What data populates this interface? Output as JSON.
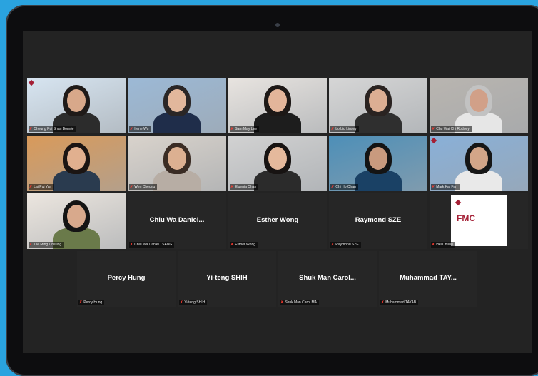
{
  "device": {
    "camera_icon": "camera-dot-icon"
  },
  "participants": [
    {
      "row": 0,
      "col": 0,
      "kind": "video",
      "label": "Cheung Pui Shan Bonnie",
      "palette": {
        "bg": "#d7e5f1",
        "skin": "#d8a88a",
        "hair": "#1f1a18",
        "cloth": "#2c2c2c"
      },
      "logo": true
    },
    {
      "row": 0,
      "col": 1,
      "kind": "video",
      "label": "Irene Wu",
      "palette": {
        "bg": "#9cb9d6",
        "skin": "#e2b79c",
        "hair": "#2a2626",
        "cloth": "#1f2d4a"
      },
      "logo": false
    },
    {
      "row": 0,
      "col": 2,
      "kind": "video",
      "label": "Sam May Lee",
      "palette": {
        "bg": "#e8e4e0",
        "skin": "#e3b59a",
        "hair": "#1d1816",
        "cloth": "#1d1d1d"
      },
      "logo": false
    },
    {
      "row": 0,
      "col": 3,
      "kind": "video",
      "label": "Lo Liu Linsey",
      "palette": {
        "bg": "#d6d6d6",
        "skin": "#dcae93",
        "hair": "#2a2321",
        "cloth": "#2f2f2f"
      },
      "logo": false
    },
    {
      "row": 0,
      "col": 4,
      "kind": "video",
      "label": "Chu Wai Chi Rodney",
      "palette": {
        "bg": "#b9b5b0",
        "skin": "#d1a088",
        "hair": "#c2c2c2",
        "cloth": "#e6e6e6"
      },
      "logo": false
    },
    {
      "row": 1,
      "col": 0,
      "kind": "video",
      "label": "Lai Pui Yan",
      "palette": {
        "bg": "#d99a5a",
        "skin": "#e1b08f",
        "hair": "#1b1513",
        "cloth": "#2a3b4f"
      },
      "logo": false
    },
    {
      "row": 1,
      "col": 1,
      "kind": "video",
      "label": "Wen Cheung",
      "palette": {
        "bg": "#d9d3cc",
        "skin": "#dcb091",
        "hair": "#3a2c24",
        "cloth": "#b7ada4"
      },
      "logo": false
    },
    {
      "row": 1,
      "col": 2,
      "kind": "video",
      "label": "Elgenia Chan",
      "palette": {
        "bg": "#d2d2d2",
        "skin": "#e5b99c",
        "hair": "#171312",
        "cloth": "#2b2b2b"
      },
      "logo": false
    },
    {
      "row": 1,
      "col": 3,
      "kind": "video",
      "label": "Chi Ho Chan",
      "palette": {
        "bg": "#4d8fb8",
        "skin": "#c99a7e",
        "hair": "#141414",
        "cloth": "#1a4165"
      },
      "logo": false
    },
    {
      "row": 1,
      "col": 4,
      "kind": "video",
      "label": "Mark Kai Fan",
      "palette": {
        "bg": "#89b0d8",
        "skin": "#d3a588",
        "hair": "#161616",
        "cloth": "#e9e9e9"
      },
      "logo": true,
      "active": true
    },
    {
      "row": 2,
      "col": 0,
      "kind": "video",
      "label": "Tse Ming Cheung",
      "palette": {
        "bg": "#ece6df",
        "skin": "#d8a98c",
        "hair": "#141414",
        "cloth": "#6a7a4a"
      },
      "logo": false
    },
    {
      "row": 2,
      "col": 1,
      "kind": "name",
      "display": "Chiu Wa Daniel...",
      "label": "Chiu Wa Daniel TSANG"
    },
    {
      "row": 2,
      "col": 2,
      "kind": "name",
      "display": "Esther Wong",
      "label": "Esther Wong"
    },
    {
      "row": 2,
      "col": 3,
      "kind": "name",
      "display": "Raymond SZE",
      "label": "Raymond SZE"
    },
    {
      "row": 2,
      "col": 4,
      "kind": "fmc",
      "label": "Hei Chung",
      "fmc_text": "FMC"
    },
    {
      "row": 3,
      "col": 0,
      "kind": "name",
      "display": "Percy Hung",
      "label": "Percy Hung"
    },
    {
      "row": 3,
      "col": 1,
      "kind": "name",
      "display": "Yi-teng SHIH",
      "label": "Yi-teng SHIH"
    },
    {
      "row": 3,
      "col": 2,
      "kind": "name",
      "display": "Shuk Man Carol...",
      "label": "Shuk Man Carol MA"
    },
    {
      "row": 3,
      "col": 3,
      "kind": "name",
      "display": "Muhammad TAY...",
      "label": "Muhammad TAYAB"
    }
  ]
}
